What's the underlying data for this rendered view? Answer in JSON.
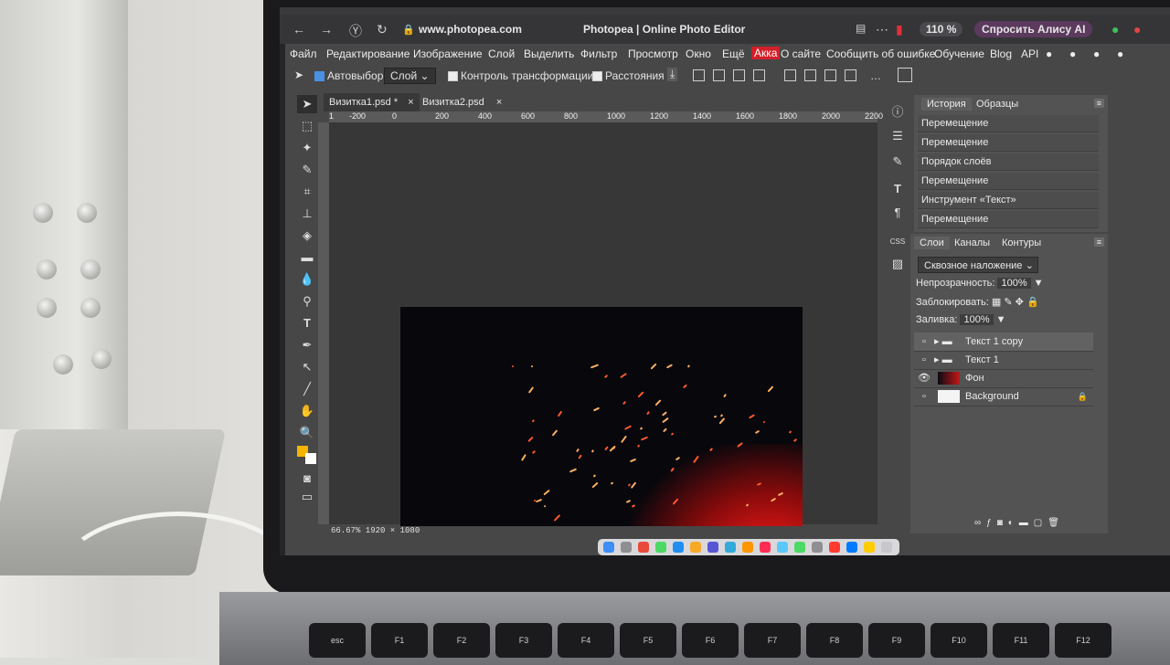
{
  "browser": {
    "url": "www.photopea.com",
    "page_title": "Photopea | Online Photo Editor",
    "zoom": "110 %",
    "assistant_button": "Спросить Алису AI"
  },
  "menu": [
    "Файл",
    "Редактирование",
    "Изображение",
    "Слой",
    "Выделить",
    "Фильтр",
    "Просмотр",
    "Окно",
    "Ещё",
    "Акка",
    "О сайте",
    "Сообщить об ошибке",
    "Обучение",
    "Blog",
    "API"
  ],
  "options": {
    "autoselect": "Автовыбор",
    "layer_select": "Слой",
    "transform": "Контроль трансформации",
    "distances": "Расстояния"
  },
  "tabs": [
    {
      "label": "Визитка1.psd *",
      "close": "×"
    },
    {
      "label": "Визитка2.psd",
      "close": "×"
    }
  ],
  "ruler_ticks": [
    "1",
    "-200",
    "0",
    "200",
    "400",
    "600",
    "800",
    "1000",
    "1200",
    "1400",
    "1600",
    "1800",
    "2000",
    "2200"
  ],
  "status": "66.67%  1920 × 1080",
  "history_panel": {
    "tabs": [
      "История",
      "Образцы"
    ],
    "items": [
      "Перемещение",
      "Перемещение",
      "Порядок слоёв",
      "Перемещение",
      "Инструмент «Текст»",
      "Перемещение"
    ]
  },
  "layers_panel": {
    "tabs": [
      "Слои",
      "Каналы",
      "Контуры"
    ],
    "blend_mode": "Сквозное наложение",
    "opacity_label": "Непрозрачность:",
    "opacity_value": "100%",
    "lock_label": "Заблокировать:",
    "fill_label": "Заливка:",
    "fill_value": "100%",
    "layers": [
      {
        "name": "Текст 1 copy",
        "type": "folder",
        "visible": false,
        "selected": true
      },
      {
        "name": "Текст 1",
        "type": "folder",
        "visible": false,
        "selected": false
      },
      {
        "name": "Фон",
        "type": "image",
        "visible": true,
        "selected": false
      },
      {
        "name": "Background",
        "type": "white",
        "visible": false,
        "selected": false,
        "locked": true
      }
    ]
  },
  "keyboard": [
    "esc",
    "F1",
    "F2",
    "F3",
    "F4",
    "F5",
    "F6",
    "F7",
    "F8",
    "F9",
    "F10",
    "F11",
    "F12"
  ],
  "colors": {
    "accent": "#d31f28",
    "panel": "#535353",
    "workspace": "#373737"
  }
}
